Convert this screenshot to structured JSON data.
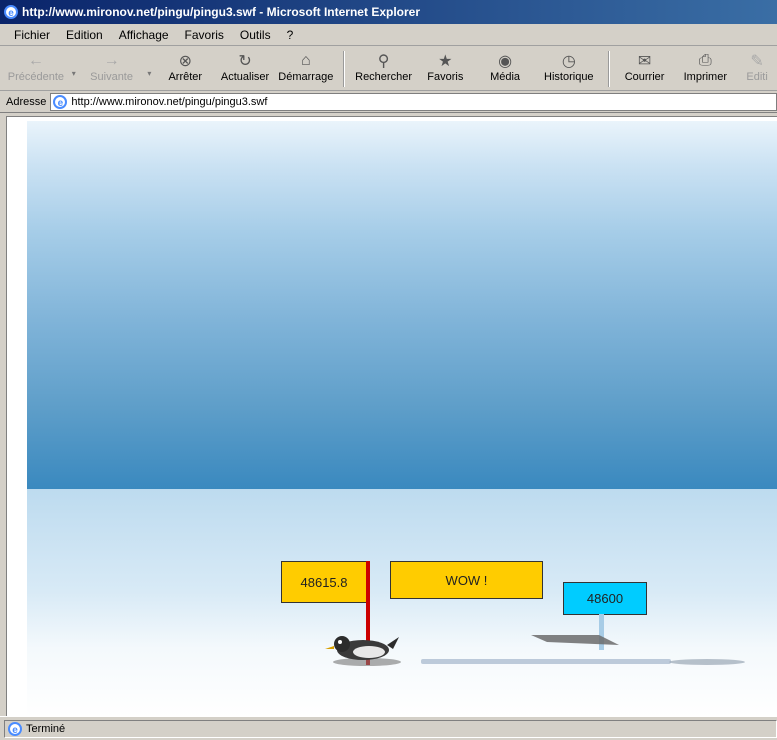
{
  "window": {
    "title": "http://www.mironov.net/pingu/pingu3.swf - Microsoft Internet Explorer",
    "icon": "ie-icon"
  },
  "menu": [
    "Fichier",
    "Edition",
    "Affichage",
    "Favoris",
    "Outils",
    "?"
  ],
  "toolbar": {
    "back": "Précédente",
    "forward": "Suivante",
    "stop": "Arrêter",
    "refresh": "Actualiser",
    "home": "Démarrage",
    "search": "Rechercher",
    "favorites": "Favoris",
    "media": "Média",
    "history": "Historique",
    "mail": "Courrier",
    "print": "Imprimer",
    "edit": "Editi"
  },
  "address": {
    "label": "Adresse",
    "url": "http://www.mironov.net/pingu/pingu3.swf"
  },
  "game": {
    "distance_value": "48615.8",
    "wow_text": "WOW !",
    "record_value": "48600",
    "colors": {
      "sign": "#ffcc00",
      "record_sign": "#00ccff",
      "pole": "#cc0000"
    }
  },
  "status": {
    "text": "Terminé"
  }
}
